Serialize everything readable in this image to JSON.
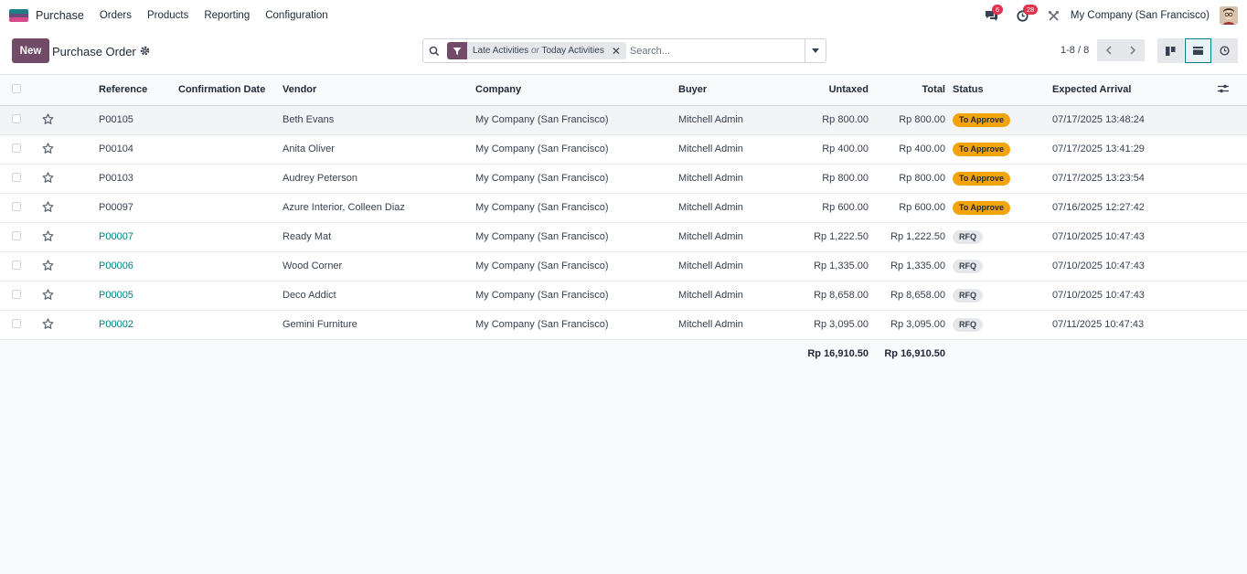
{
  "navbar": {
    "app_name": "Purchase",
    "menu": [
      "Orders",
      "Products",
      "Reporting",
      "Configuration"
    ],
    "messages_count": "6",
    "activities_count": "28",
    "company": "My Company (San Francisco)"
  },
  "control": {
    "new_label": "New",
    "title": "Purchase Order",
    "facet_part1": "Late Activities",
    "facet_or": "or",
    "facet_part2": "Today Activities",
    "search_placeholder": "Search...",
    "pager": "1-8 / 8"
  },
  "columns": {
    "reference": "Reference",
    "confirmation_date": "Confirmation Date",
    "vendor": "Vendor",
    "company": "Company",
    "buyer": "Buyer",
    "untaxed": "Untaxed",
    "total": "Total",
    "status": "Status",
    "expected_arrival": "Expected Arrival"
  },
  "rows": [
    {
      "reference": "P00105",
      "link": false,
      "confirmation_date": "",
      "vendor": "Beth Evans",
      "company": "My Company (San Francisco)",
      "buyer": "Mitchell Admin",
      "untaxed": "Rp 800.00",
      "total": "Rp 800.00",
      "status": "To Approve",
      "expected_arrival": "07/17/2025 13:48:24"
    },
    {
      "reference": "P00104",
      "link": false,
      "confirmation_date": "",
      "vendor": "Anita Oliver",
      "company": "My Company (San Francisco)",
      "buyer": "Mitchell Admin",
      "untaxed": "Rp 400.00",
      "total": "Rp 400.00",
      "status": "To Approve",
      "expected_arrival": "07/17/2025 13:41:29"
    },
    {
      "reference": "P00103",
      "link": false,
      "confirmation_date": "",
      "vendor": "Audrey Peterson",
      "company": "My Company (San Francisco)",
      "buyer": "Mitchell Admin",
      "untaxed": "Rp 800.00",
      "total": "Rp 800.00",
      "status": "To Approve",
      "expected_arrival": "07/17/2025 13:23:54"
    },
    {
      "reference": "P00097",
      "link": false,
      "confirmation_date": "",
      "vendor": "Azure Interior, Colleen Diaz",
      "company": "My Company (San Francisco)",
      "buyer": "Mitchell Admin",
      "untaxed": "Rp 600.00",
      "total": "Rp 600.00",
      "status": "To Approve",
      "expected_arrival": "07/16/2025 12:27:42"
    },
    {
      "reference": "P00007",
      "link": true,
      "confirmation_date": "",
      "vendor": "Ready Mat",
      "company": "My Company (San Francisco)",
      "buyer": "Mitchell Admin",
      "untaxed": "Rp 1,222.50",
      "total": "Rp 1,222.50",
      "status": "RFQ",
      "expected_arrival": "07/10/2025 10:47:43"
    },
    {
      "reference": "P00006",
      "link": true,
      "confirmation_date": "",
      "vendor": "Wood Corner",
      "company": "My Company (San Francisco)",
      "buyer": "Mitchell Admin",
      "untaxed": "Rp 1,335.00",
      "total": "Rp 1,335.00",
      "status": "RFQ",
      "expected_arrival": "07/10/2025 10:47:43"
    },
    {
      "reference": "P00005",
      "link": true,
      "confirmation_date": "",
      "vendor": "Deco Addict",
      "company": "My Company (San Francisco)",
      "buyer": "Mitchell Admin",
      "untaxed": "Rp 8,658.00",
      "total": "Rp 8,658.00",
      "status": "RFQ",
      "expected_arrival": "07/10/2025 10:47:43"
    },
    {
      "reference": "P00002",
      "link": true,
      "confirmation_date": "",
      "vendor": "Gemini Furniture",
      "company": "My Company (San Francisco)",
      "buyer": "Mitchell Admin",
      "untaxed": "Rp 3,095.00",
      "total": "Rp 3,095.00",
      "status": "RFQ",
      "expected_arrival": "07/11/2025 10:47:43"
    }
  ],
  "totals": {
    "untaxed": "Rp 16,910.50",
    "total": "Rp 16,910.50"
  },
  "colors": {
    "brand": "#714b67",
    "link": "#017e84",
    "to_approve": "#f4a40b",
    "badge": "#e0334e"
  },
  "icons": [
    "app-icon",
    "search-icon",
    "filter-icon",
    "close-icon",
    "caret-down-icon",
    "chevron-left-icon",
    "chevron-right-icon",
    "kanban-icon",
    "list-icon",
    "activity-clock-icon",
    "chat-icon",
    "clock-icon",
    "tools-icon",
    "gear-icon",
    "star-icon",
    "optional-columns-icon"
  ]
}
